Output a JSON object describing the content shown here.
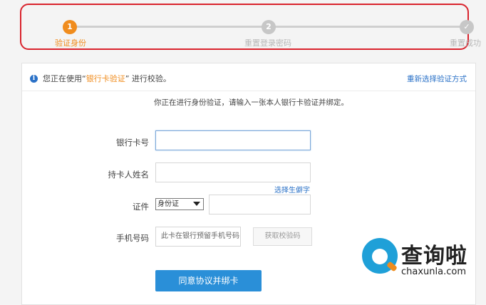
{
  "stepper": {
    "steps": [
      {
        "num": "1",
        "label": "验证身份",
        "state": "active"
      },
      {
        "num": "2",
        "label": "重置登录密码",
        "state": "pending"
      },
      {
        "num": "✓",
        "label": "重置成功",
        "state": "pending"
      }
    ]
  },
  "notice": {
    "prefix": "您正在使用“",
    "method": "银行卡验证",
    "suffix": "” 进行校验。",
    "switch_link": "重新选择验证方式"
  },
  "subtitle": "你正在进行身份验证，请输入一张本人银行卡验证并绑定。",
  "form": {
    "card_number_label": "银行卡号",
    "card_number_value": "",
    "holder_name_label": "持卡人姓名",
    "holder_name_value": "",
    "rare_char_link": "选择生僻字",
    "id_label": "证件",
    "id_type_selected": "身份证",
    "id_number_value": "",
    "phone_label": "手机号码",
    "phone_placeholder": "此卡在银行预留手机号码",
    "sms_button": "获取校验码",
    "submit_button": "同意协议并绑卡"
  },
  "watermark": {
    "title": "查询啦",
    "site": "chaxunla.com"
  },
  "colors": {
    "accent_orange": "#f08c1d",
    "link_blue": "#2a71c7",
    "button_blue": "#2a8fd8",
    "highlight_red": "#d9232d"
  }
}
